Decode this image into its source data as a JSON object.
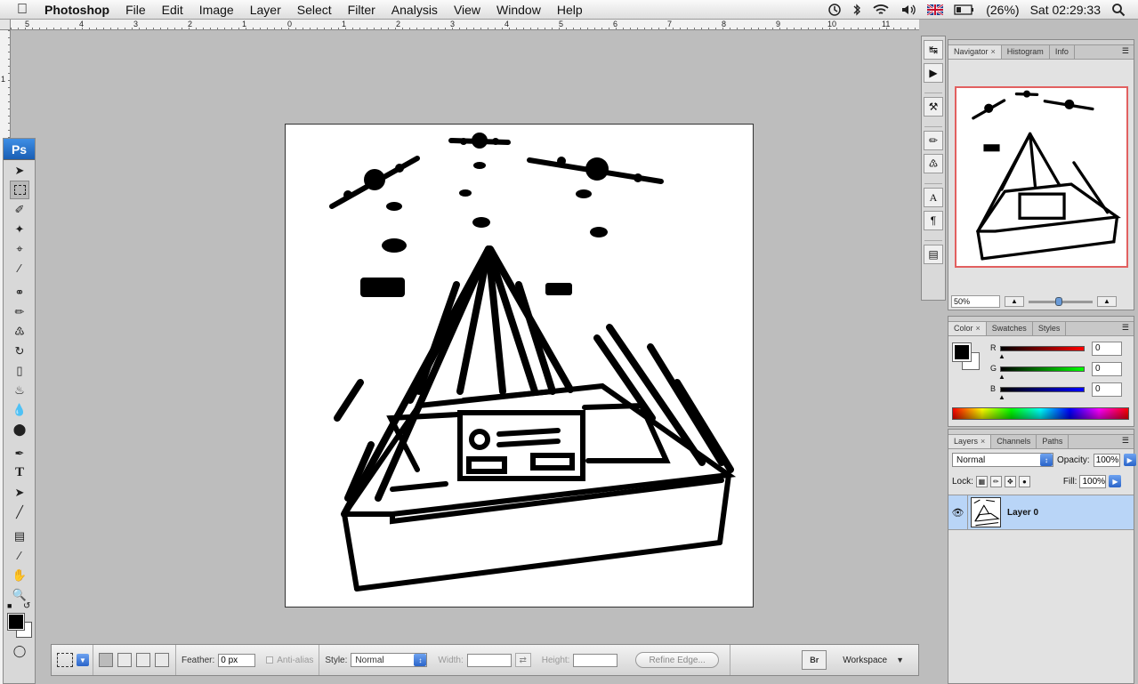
{
  "menubar": {
    "app_name": "Photoshop",
    "items": [
      "File",
      "Edit",
      "Image",
      "Layer",
      "Select",
      "Filter",
      "Analysis",
      "View",
      "Window",
      "Help"
    ],
    "battery": "(26%)",
    "clock": "Sat 02:29:33"
  },
  "ruler": {
    "h_ticks": [
      "5",
      "4",
      "3",
      "2",
      "1",
      "0",
      "1",
      "2",
      "3",
      "4",
      "5",
      "6",
      "7",
      "8",
      "9",
      "10",
      "11"
    ],
    "v_ticks": [
      "1"
    ]
  },
  "toolbox": {
    "logo": "Ps"
  },
  "options": {
    "feather_label": "Feather:",
    "feather_value": "0 px",
    "antialias_label": "Anti-alias",
    "style_label": "Style:",
    "style_value": "Normal",
    "width_label": "Width:",
    "width_value": "",
    "height_label": "Height:",
    "height_value": "",
    "refine_edge": "Refine Edge...",
    "workspace": "Workspace"
  },
  "navigator": {
    "tabs": [
      "Navigator",
      "Histogram",
      "Info"
    ],
    "zoom": "50%"
  },
  "color_panel": {
    "tabs": [
      "Color",
      "Swatches",
      "Styles"
    ],
    "r_label": "R",
    "r_value": "0",
    "g_label": "G",
    "g_value": "0",
    "b_label": "B",
    "b_value": "0"
  },
  "layers_panel": {
    "tabs": [
      "Layers",
      "Channels",
      "Paths"
    ],
    "blend_mode": "Normal",
    "opacity_label": "Opacity:",
    "opacity_value": "100%",
    "lock_label": "Lock:",
    "fill_label": "Fill:",
    "fill_value": "100%",
    "layer_name": "Layer 0"
  }
}
